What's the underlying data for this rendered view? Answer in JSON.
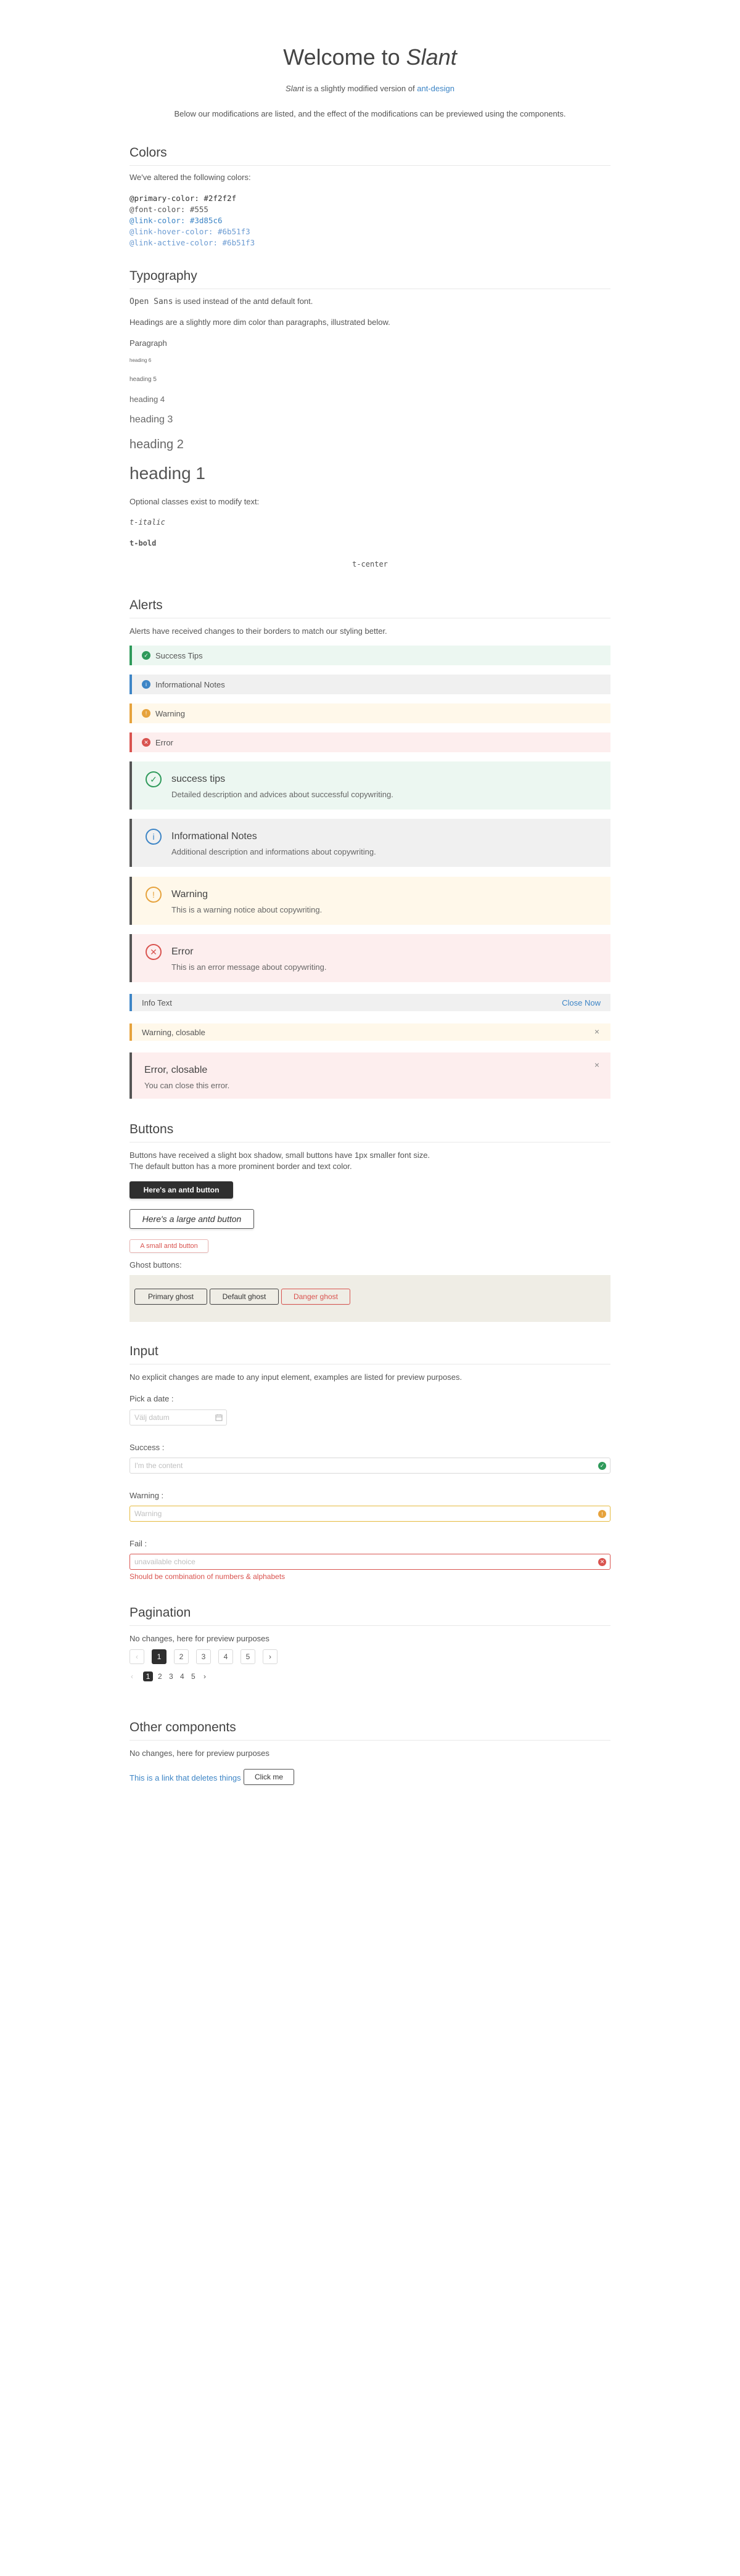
{
  "hero": {
    "title_prefix": "Welcome to ",
    "title_em": "Slant",
    "sub_em": "Slant",
    "sub_text": " is a slightly modified version of ",
    "sub_link": "ant-design",
    "sub2": "Below our modifications are listed, and the effect of the modifications can be previewed using the components."
  },
  "colors": {
    "title": "Colors",
    "intro": "We've altered the following colors:",
    "lines": [
      {
        "text": "@primary-color: #2f2f2f",
        "color": "#2f2f2f"
      },
      {
        "text": "@font-color: #555",
        "color": "#555555"
      },
      {
        "text": "@link-color: #3d85c6",
        "color": "#3d85c6"
      },
      {
        "text": "@link-hover-color: #6b51f3",
        "color": "#6b9bd2"
      },
      {
        "text": "@link-active-color: #6b51f3",
        "color": "#6b9bd2"
      }
    ]
  },
  "typography": {
    "title": "Typography",
    "font_code": "Open Sans",
    "font_text": " is used instead of the antd default font.",
    "headings_note": "Headings are a slightly more dim color than paragraphs, illustrated below.",
    "paragraph": "Paragraph",
    "h6": "heading 6",
    "h5": "heading 5",
    "h4": "heading 4",
    "h3": "heading 3",
    "h2": "heading 2",
    "h1": "heading 1",
    "optional": "Optional classes exist to modify text:",
    "italic": "t-italic",
    "bold": "t-bold",
    "center": "t-center"
  },
  "alerts": {
    "title": "Alerts",
    "intro": "Alerts have received changes to their borders to match our styling better.",
    "small": [
      "Success Tips",
      "Informational Notes",
      "Warning",
      "Error"
    ],
    "big": [
      {
        "title": "success tips",
        "desc": "Detailed description and advices about successful copywriting."
      },
      {
        "title": "Informational Notes",
        "desc": "Additional description and informations about copywriting."
      },
      {
        "title": "Warning",
        "desc": "This is a warning notice about copywriting."
      },
      {
        "title": "Error",
        "desc": "This is an error message about copywriting."
      }
    ],
    "info_text": "Info Text",
    "close_now": "Close Now",
    "warn_closable": "Warning, closable",
    "err_closable_title": "Error, closable",
    "err_closable_desc": "You can close this error.",
    "close_glyph": "×"
  },
  "buttons": {
    "title": "Buttons",
    "desc1": "Buttons have received a slight box shadow, small buttons have 1px smaller font size.",
    "desc2": "The default button has a more prominent border and text color.",
    "primary": "Here's an antd button",
    "large": "Here's a large antd button",
    "small": "A small antd button",
    "ghost_label": "Ghost buttons:",
    "ghost_primary": "Primary ghost",
    "ghost_default": "Default ghost",
    "ghost_danger": "Danger ghost"
  },
  "input": {
    "title": "Input",
    "intro": "No explicit changes are made to any input element, examples are listed for preview purposes.",
    "date_label": "Pick a date :",
    "date_placeholder": "Välj datum",
    "success_label": "Success :",
    "success_placeholder": "I'm the content",
    "warning_label": "Warning :",
    "warning_placeholder": "Warning",
    "fail_label": "Fail :",
    "fail_placeholder": "unavailable choice",
    "fail_help": "Should be combination of numbers & alphabets"
  },
  "pagination": {
    "title": "Pagination",
    "intro": "No changes, here for preview purposes",
    "prev": "‹",
    "next": "›",
    "pages": [
      "1",
      "2",
      "3",
      "4",
      "5"
    ],
    "current": "1"
  },
  "other": {
    "title": "Other components",
    "intro": "No changes, here for preview purposes",
    "link": "This is a link that deletes things",
    "button": "Click me"
  }
}
